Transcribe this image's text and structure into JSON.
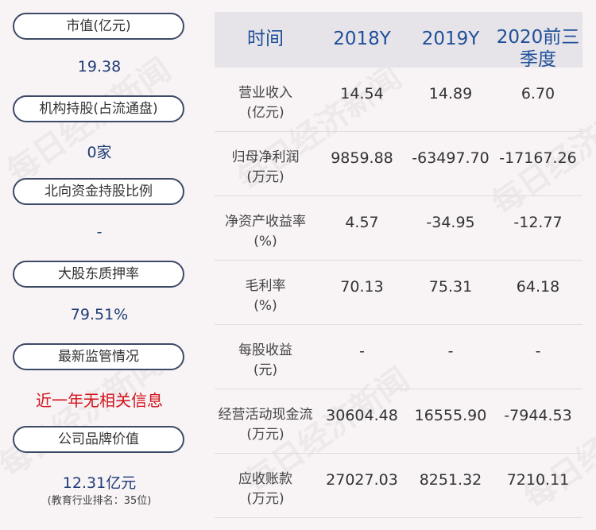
{
  "left_panel": [
    {
      "label": "市值(亿元)",
      "value": "19.38"
    },
    {
      "label": "机构持股(占流通盘)",
      "value": "0家"
    },
    {
      "label": "北向资金持股比例",
      "value": "-"
    },
    {
      "label": "大股东质押率",
      "value": "79.51%"
    },
    {
      "label": "最新监管情况",
      "value": "近一年无相关信息"
    },
    {
      "label": "公司品牌价值",
      "value": "12.31亿元",
      "note": "(教育行业排名：35位)"
    }
  ],
  "table": {
    "headers": [
      "时间",
      "2018Y",
      "2019Y",
      "2020前三季度"
    ],
    "rows": [
      {
        "label": "营业收入\n(亿元)",
        "values": [
          "14.54",
          "14.89",
          "6.70"
        ]
      },
      {
        "label": "归母净利润\n(万元)",
        "values": [
          "9859.88",
          "-63497.70",
          "-17167.26"
        ]
      },
      {
        "label": "净资产收益率\n(%)",
        "values": [
          "4.57",
          "-34.95",
          "-12.77"
        ]
      },
      {
        "label": "毛利率\n(%)",
        "values": [
          "70.13",
          "75.31",
          "64.18"
        ]
      },
      {
        "label": "每股收益\n(元)",
        "values": [
          "-",
          "-",
          "-"
        ]
      },
      {
        "label": "经营活动现金流\n(万元)",
        "values": [
          "30604.48",
          "16555.90",
          "-7944.53"
        ]
      },
      {
        "label": "应收账款\n(万元)",
        "values": [
          "27027.03",
          "8251.32",
          "7210.11"
        ]
      }
    ]
  },
  "watermark": "每日经济新闻"
}
